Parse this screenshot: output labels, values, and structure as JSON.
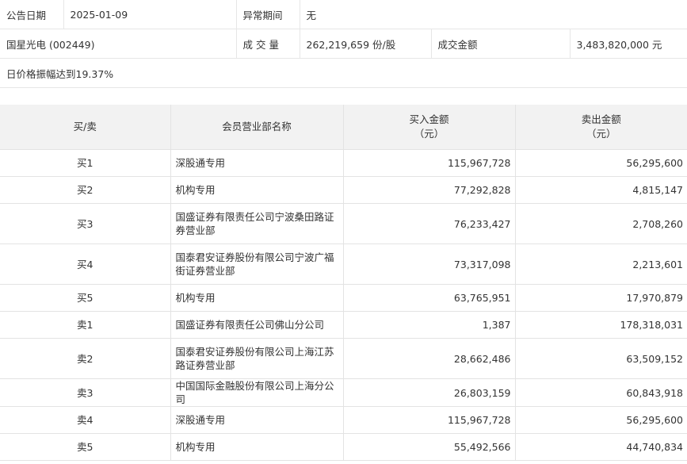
{
  "info": {
    "announce_date_label": "公告日期",
    "announce_date": "2025-01-09",
    "abnormal_period_label": "异常期间",
    "abnormal_period": "无",
    "stock": "国星光电 (002449)",
    "volume_label": "成 交 量",
    "volume": "262,219,659 份/股",
    "amount_label": "成交金额",
    "amount": "3,483,820,000 元",
    "reason": "日价格振幅达到19.37%"
  },
  "table": {
    "headers": {
      "side": "买/卖",
      "branch": "会员营业部名称",
      "buy_line1": "买入金额",
      "buy_line2": "（元）",
      "sell_line1": "卖出金额",
      "sell_line2": "（元）"
    },
    "rows": [
      {
        "side": "买1",
        "branch": "深股通专用",
        "buy": "115,967,728",
        "sell": "56,295,600"
      },
      {
        "side": "买2",
        "branch": "机构专用",
        "buy": "77,292,828",
        "sell": "4,815,147"
      },
      {
        "side": "买3",
        "branch": "国盛证券有限责任公司宁波桑田路证券营业部",
        "buy": "76,233,427",
        "sell": "2,708,260"
      },
      {
        "side": "买4",
        "branch": "国泰君安证券股份有限公司宁波广福街证券营业部",
        "buy": "73,317,098",
        "sell": "2,213,601"
      },
      {
        "side": "买5",
        "branch": "机构专用",
        "buy": "63,765,951",
        "sell": "17,970,879"
      },
      {
        "side": "卖1",
        "branch": "国盛证券有限责任公司佛山分公司",
        "buy": "1,387",
        "sell": "178,318,031"
      },
      {
        "side": "卖2",
        "branch": "国泰君安证券股份有限公司上海江苏路证券营业部",
        "buy": "28,662,486",
        "sell": "63,509,152"
      },
      {
        "side": "卖3",
        "branch": "中国国际金融股份有限公司上海分公司",
        "buy": "26,803,159",
        "sell": "60,843,918"
      },
      {
        "side": "卖4",
        "branch": "深股通专用",
        "buy": "115,967,728",
        "sell": "56,295,600"
      },
      {
        "side": "卖5",
        "branch": "机构专用",
        "buy": "55,492,566",
        "sell": "44,740,834"
      }
    ]
  }
}
